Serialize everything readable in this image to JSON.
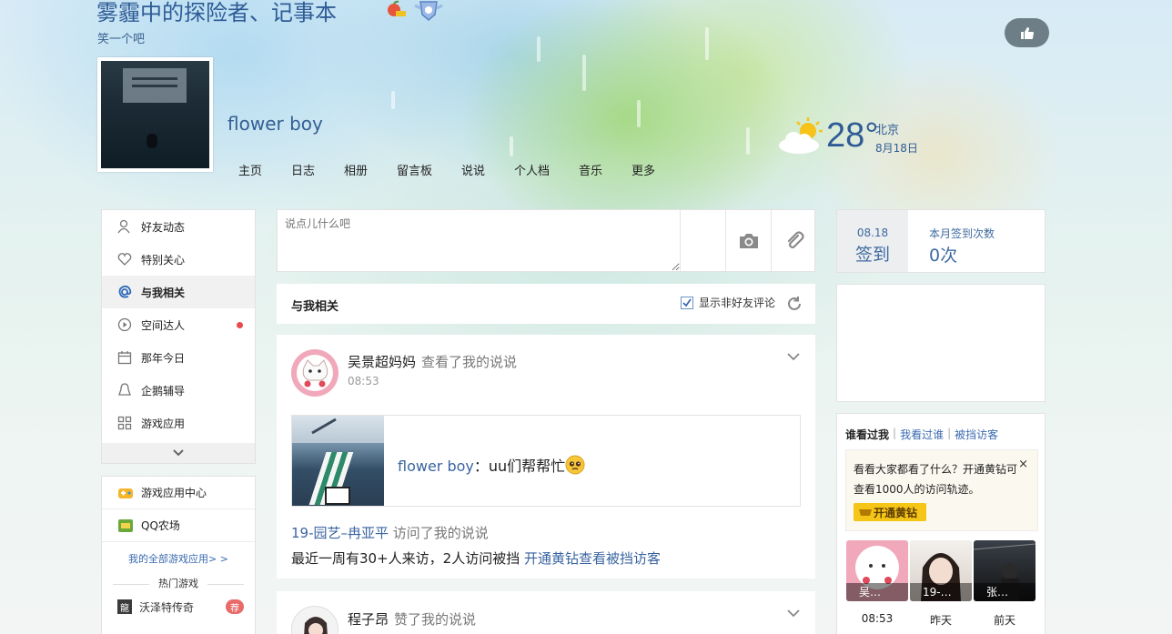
{
  "header": {
    "site_title": "雾霾中的探险者、记事本",
    "subtitle": "笑一个吧",
    "user_name": "flower boy"
  },
  "nav": [
    "主页",
    "日志",
    "相册",
    "留言板",
    "说说",
    "个人档",
    "音乐",
    "更多"
  ],
  "weather": {
    "temp": "28°",
    "city": "北京",
    "date": "8月18日"
  },
  "sidebar": {
    "items": [
      {
        "label": "好友动态",
        "icon": "friends-icon"
      },
      {
        "label": "特别关心",
        "icon": "heart-icon"
      },
      {
        "label": "与我相关",
        "icon": "at-icon"
      },
      {
        "label": "空间达人",
        "icon": "play-icon"
      },
      {
        "label": "那年今日",
        "icon": "calendar-icon"
      },
      {
        "label": "企鹅辅导",
        "icon": "penguin-icon"
      },
      {
        "label": "游戏应用",
        "icon": "grid-icon"
      }
    ]
  },
  "games": {
    "center": "游戏应用中心",
    "farm": "QQ农场",
    "all_link": "我的全部游戏应用> >",
    "hot_title": "热门游戏",
    "hot_game": "沃泽特传奇",
    "hot_tag": "荐",
    "hot_game_icon_char": "龍"
  },
  "composer": {
    "placeholder": "说点儿什么吧"
  },
  "feed": {
    "title": "与我相关",
    "show_nonfriend": "显示非好友评论"
  },
  "card1": {
    "user": "吴景超妈妈",
    "action": "查看了我的说说",
    "time": "08:53",
    "quote_user": "flower boy",
    "quote_sep": "：",
    "quote_text": "uu们帮帮忙",
    "visit_user": "19-园艺–冉亚平",
    "visit_action": "访问了我的说说",
    "visit_summary": "最近一周有30+人来访，2人访问被挡",
    "visit_link": "开通黄钻查看被挡访客"
  },
  "card2": {
    "user": "程子昂",
    "action": "赞了我的说说"
  },
  "checkin": {
    "date": "08.18",
    "label": "签到",
    "month_label": "本月签到次数",
    "count": "0次"
  },
  "visitors": {
    "tabs": [
      "谁看过我",
      "我看过谁",
      "被挡访客"
    ],
    "promo_text": "看看大家都看了什么？开通黄钻可查看1000人的访问轨迹。",
    "promo_close": "×",
    "promo_btn": "开通黄钻",
    "list": [
      {
        "name": "吴…",
        "time": "08:53"
      },
      {
        "name": "19-…",
        "time": "昨天"
      },
      {
        "name": "张…",
        "time": "前天"
      }
    ]
  },
  "colors": {
    "accent": "#2f5c96",
    "link": "#3a64a0",
    "brand_yellow": "#f5c518"
  }
}
